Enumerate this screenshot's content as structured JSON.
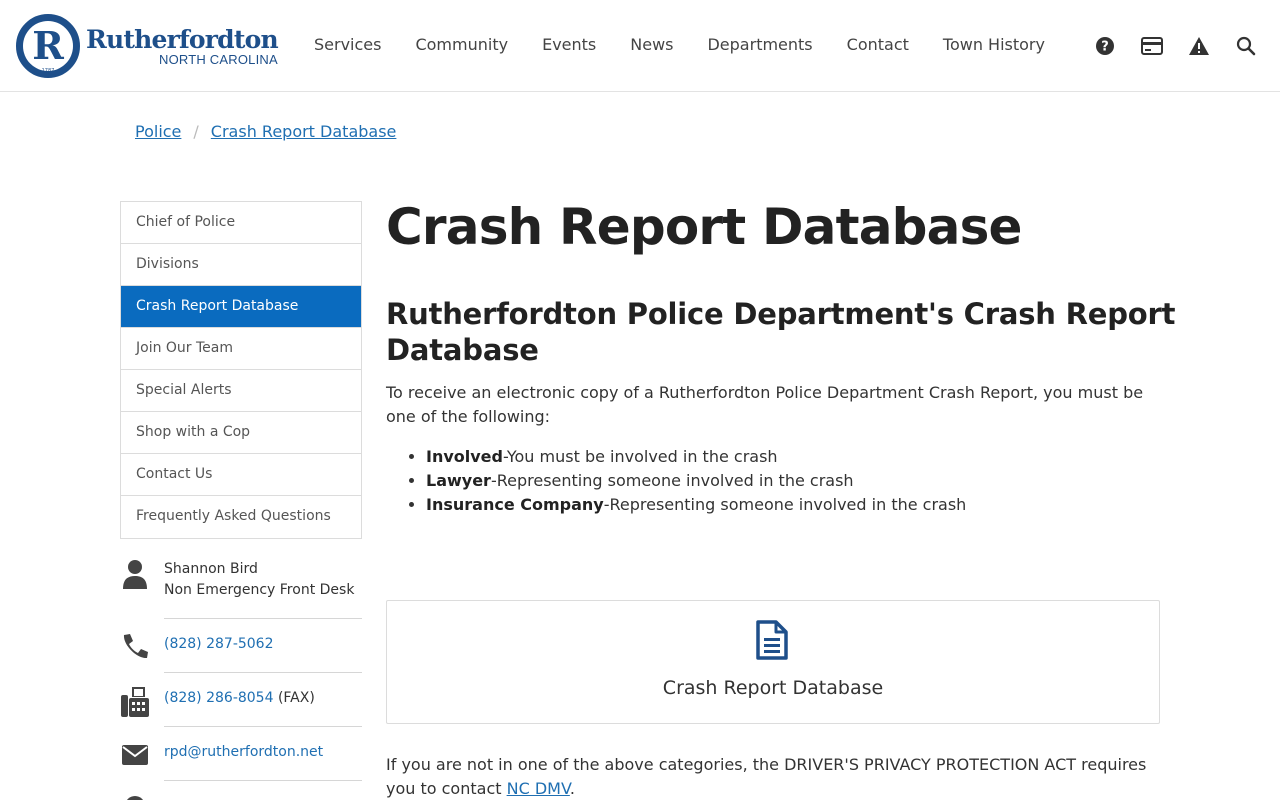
{
  "site": {
    "name": "Rutherfordton",
    "state": "NORTH CAROLINA",
    "seal_letter": "R",
    "seal_year": "1787"
  },
  "nav": {
    "items": [
      "Services",
      "Community",
      "Events",
      "News",
      "Departments",
      "Contact",
      "Town History"
    ],
    "icons": [
      "help-icon",
      "payment-card-icon",
      "alert-icon",
      "search-icon"
    ]
  },
  "breadcrumb": {
    "items": [
      "Police",
      "Crash Report Database"
    ],
    "separator": "/"
  },
  "sidebar": {
    "items": [
      {
        "label": "Chief of Police",
        "active": false
      },
      {
        "label": "Divisions",
        "active": false
      },
      {
        "label": "Crash Report Database",
        "active": true
      },
      {
        "label": "Join Our Team",
        "active": false
      },
      {
        "label": "Special Alerts",
        "active": false
      },
      {
        "label": "Shop with a Cop",
        "active": false
      },
      {
        "label": "Contact Us",
        "active": false
      },
      {
        "label": "Frequently Asked Questions",
        "active": false
      }
    ]
  },
  "contact": {
    "name": "Shannon Bird",
    "role": "Non Emergency Front Desk",
    "phone": "(828) 287-5062",
    "fax": "(828) 286-8054",
    "fax_suffix": "(FAX)",
    "email": "rpd@rutherfordton.net"
  },
  "main": {
    "title": "Crash Report Database",
    "subtitle": "Rutherfordton Police Department's Crash Report Database",
    "intro": "To receive an electronic copy of a Rutherfordton Police Department Crash Report, you must be one of the following:",
    "categories": [
      {
        "term": "Involved",
        "desc": "-You must be involved in the crash"
      },
      {
        "term": "Lawyer",
        "desc": "-Representing someone involved in the crash"
      },
      {
        "term": "Insurance Company",
        "desc": "-Representing someone involved in the crash"
      }
    ],
    "card_label": "Crash Report Database",
    "footer_text": "If you are not in one of the above categories, the DRIVER'S PRIVACY PROTECTION ACT requires you to contact ",
    "footer_link": "NC DMV",
    "footer_end": "."
  },
  "colors": {
    "brand": "#1e4f8a",
    "link": "#1f6fb2",
    "active": "#0a6bbf"
  }
}
